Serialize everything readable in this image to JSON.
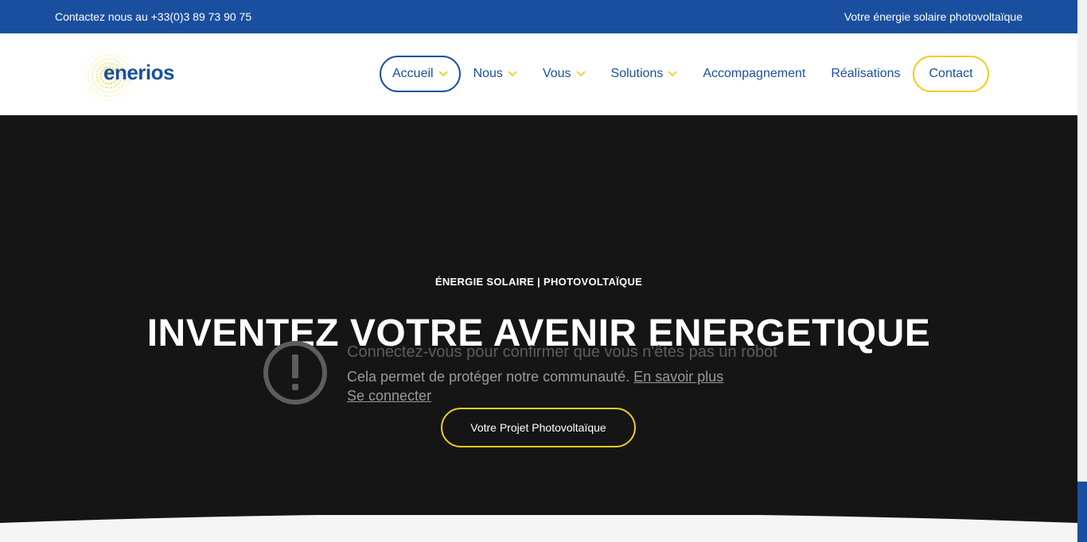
{
  "topbar": {
    "phone": "Contactez nous au +33(0)3 89 73 90 75",
    "tagline": "Votre énergie solaire photovoltaïque"
  },
  "brand": {
    "name": "enerios",
    "logo_icon": "sun-dots-logo",
    "colors": {
      "blue": "#1a4fa0",
      "yellow": "#f2cd1e",
      "hero_bg": "#151515"
    }
  },
  "nav": {
    "items": [
      {
        "label": "Accueil",
        "has_dropdown": true,
        "active": true
      },
      {
        "label": "Nous",
        "has_dropdown": true
      },
      {
        "label": "Vous",
        "has_dropdown": true
      },
      {
        "label": "Solutions",
        "has_dropdown": true
      },
      {
        "label": "Accompagnement",
        "has_dropdown": false
      },
      {
        "label": "Réalisations",
        "has_dropdown": false
      }
    ],
    "contact_label": "Contact"
  },
  "hero": {
    "kicker": "ÉNERGIE SOLAIRE | PHOTOVOLTAÏQUE",
    "title": "INVENTEZ VOTRE AVENIR ENERGETIQUE",
    "cta_label": "Votre Projet Photovoltaïque"
  },
  "robot_check": {
    "icon": "exclamation-circle-icon",
    "heading": "Connectez-vous pour confirmer que vous n'êtes pas un robot",
    "text": "Cela permet de protéger notre communauté.",
    "learn_more": "En savoir plus",
    "login": "Se connecter"
  }
}
